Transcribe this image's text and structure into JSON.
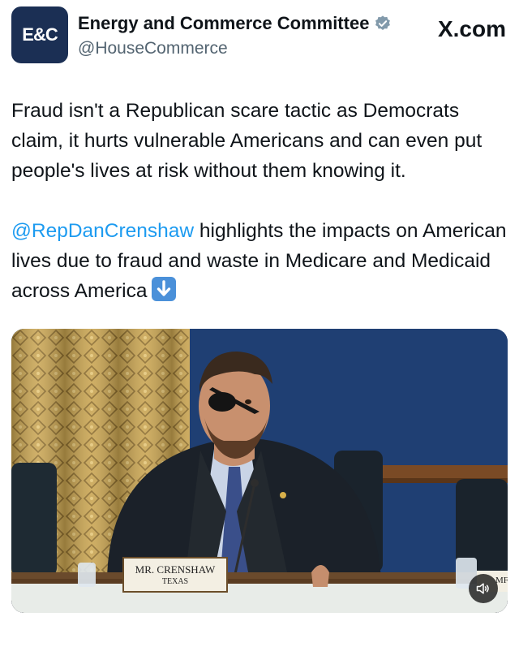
{
  "account": {
    "avatar_text": "E&C",
    "display_name": "Energy and Commerce Committee",
    "handle": "@HouseCommerce",
    "verified_icon": "verified-badge-icon",
    "source": "X.com"
  },
  "tweet": {
    "paragraph1": "Fraud isn't a Republican scare tactic as Democrats claim, it hurts vulnerable Americans and can even put people's lives at risk without them knowing it.",
    "mention": "@RepDanCrenshaw",
    "paragraph2_rest": " highlights the impacts on American lives due to fraud and waste in Medicare and Medicaid across America",
    "emoji_icon": "down-arrow-emoji-icon"
  },
  "media": {
    "nameplate_name": "MR. CRENSHAW",
    "nameplate_state": "TEXAS",
    "right_nameplate_partial": "MF",
    "speaker_icon": "speaker-muted-icon"
  },
  "colors": {
    "mention": "#1d9bf0",
    "avatar_bg": "#1b2f54",
    "verified": "#829aab"
  }
}
